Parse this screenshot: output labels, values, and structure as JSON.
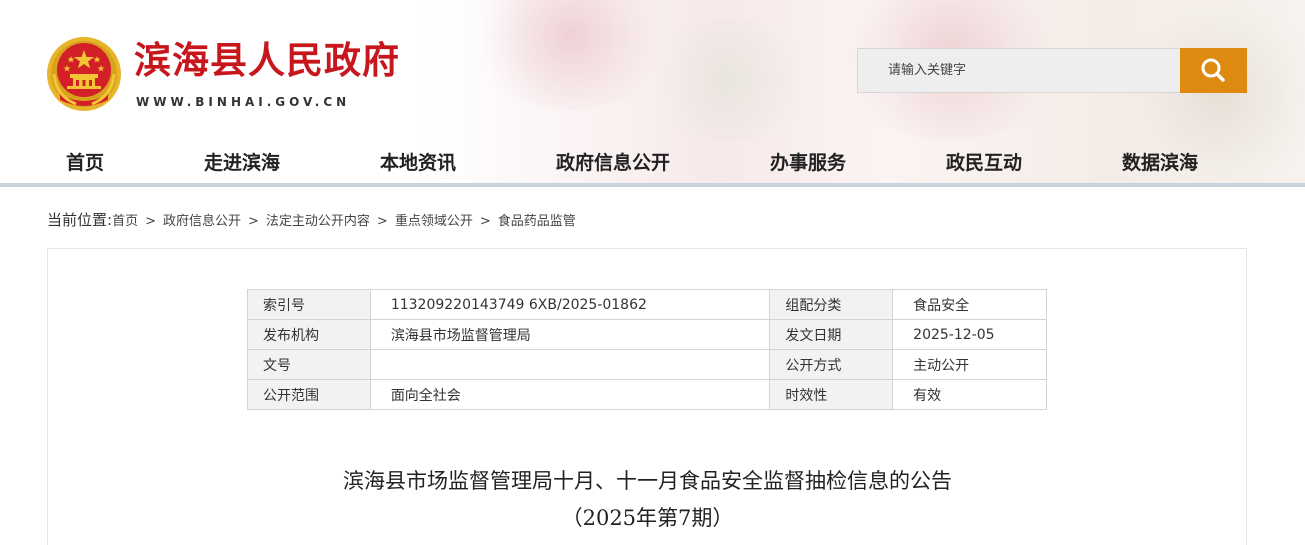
{
  "site": {
    "title": "滨海县人民政府",
    "domain": "WWW.BINHAI.GOV.CN"
  },
  "search": {
    "placeholder": "请输入关键字",
    "button_icon": "search-icon",
    "button_color": "#de8a11"
  },
  "nav": {
    "items": [
      "首页",
      "走进滨海",
      "本地资讯",
      "政府信息公开",
      "办事服务",
      "政民互动",
      "数据滨海"
    ]
  },
  "breadcrumb": {
    "label": "当前位置:",
    "items": [
      "首页",
      "政府信息公开",
      "法定主动公开内容",
      "重点领域公开",
      "食品药品监管"
    ],
    "separator": ">"
  },
  "meta_table": {
    "rows": [
      [
        "索引号",
        "113209220143749 6XB/2025-01862",
        "组配分类",
        "食品安全"
      ],
      [
        "发布机构",
        "滨海县市场监督管理局",
        "发文日期",
        "2025-12-05"
      ],
      [
        "文号",
        "",
        "公开方式",
        "主动公开"
      ],
      [
        "公开范围",
        "面向全社会",
        "时效性",
        "有效"
      ]
    ]
  },
  "article": {
    "title_line1": "滨海县市场监督管理局十月、十一月食品安全监督抽检信息的公告",
    "title_line2": "（2025年第7期）"
  },
  "colors": {
    "brand_red": "#c8161d",
    "nav_line": "#c6d2de"
  }
}
